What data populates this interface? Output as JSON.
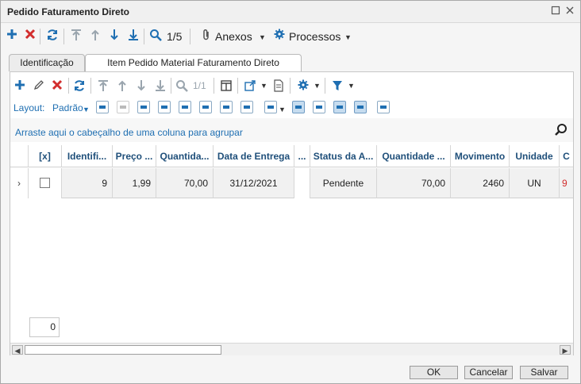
{
  "window": {
    "title": "Pedido Faturamento Direto"
  },
  "main_toolbar": {
    "record_pos": "1/5",
    "anexos_label": "Anexos",
    "processos_label": "Processos"
  },
  "tabs": [
    {
      "label": "Identificação"
    },
    {
      "label": "Item Pedido Material Faturamento Direto"
    }
  ],
  "sub_toolbar": {
    "record_pos": "1/1"
  },
  "layout_bar": {
    "label": "Layout:",
    "layout_value": "Padrão"
  },
  "group_bar": {
    "text": "Arraste aqui o cabeçalho de uma coluna para agrupar"
  },
  "grid": {
    "headers": [
      "[x]",
      "Identifi...",
      "Preço ...",
      "Quantida...",
      "Data de Entrega",
      "...",
      "Status da A...",
      "Quantidade ...",
      "Movimento",
      "Unidade",
      "C"
    ],
    "row": {
      "id": "9",
      "preco": "1,99",
      "quantidade": "70,00",
      "data_entrega": "31/12/2021",
      "status": "Pendente",
      "quantidade2": "70,00",
      "movimento": "2460",
      "unidade": "UN",
      "extra": "9"
    }
  },
  "footer": {
    "count": "0"
  },
  "buttons": {
    "ok": "OK",
    "cancel": "Cancelar",
    "save": "Salvar"
  }
}
